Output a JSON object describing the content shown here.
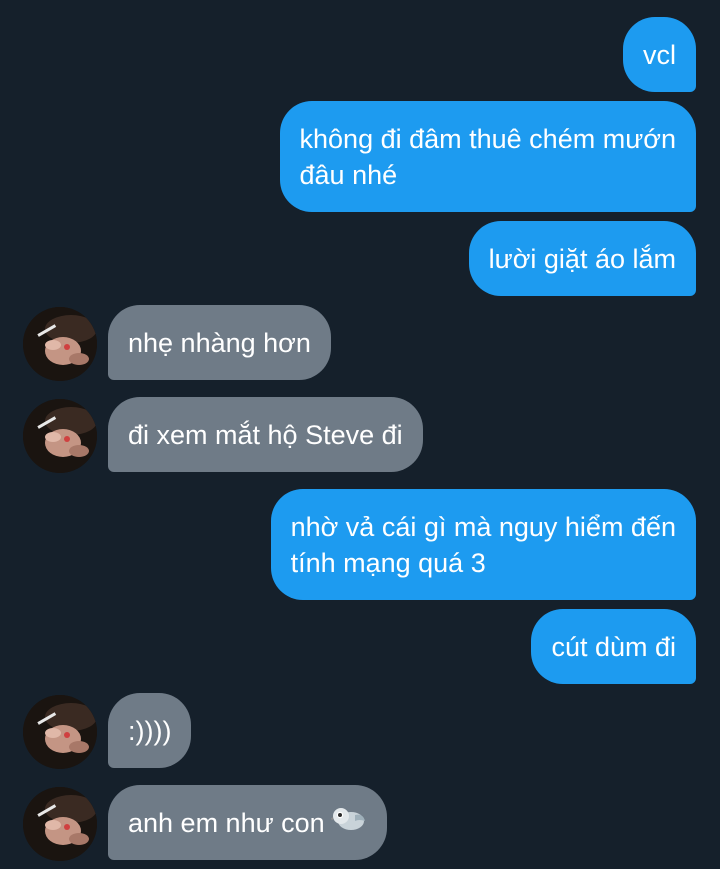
{
  "messages": [
    {
      "side": "sent",
      "lines": [
        "vcl"
      ]
    },
    {
      "side": "sent",
      "lines": [
        "không đi đâm thuê chém mướn",
        "đâu nhé"
      ]
    },
    {
      "side": "sent",
      "lines": [
        "lười giặt áo lắm"
      ]
    },
    {
      "side": "received",
      "lines": [
        "nhẹ nhàng hơn"
      ]
    },
    {
      "side": "received",
      "lines": [
        "đi xem mắt hộ Steve đi"
      ]
    },
    {
      "side": "sent",
      "lines": [
        "nhờ vả cái gì mà nguy hiểm đến",
        "tính mạng quá 3"
      ]
    },
    {
      "side": "sent",
      "lines": [
        "cút dùm đi"
      ]
    },
    {
      "side": "received",
      "lines": [
        ":))))"
      ]
    },
    {
      "side": "received",
      "lines": [
        "anh em như con"
      ],
      "trailing_emoji": "pigeon-emoji"
    }
  ],
  "colors": {
    "background": "#15202b",
    "sent_bubble": "#1d9bf0",
    "received_bubble": "#6f7b87",
    "text": "#ffffff"
  },
  "avatar_icon": "contact-avatar"
}
